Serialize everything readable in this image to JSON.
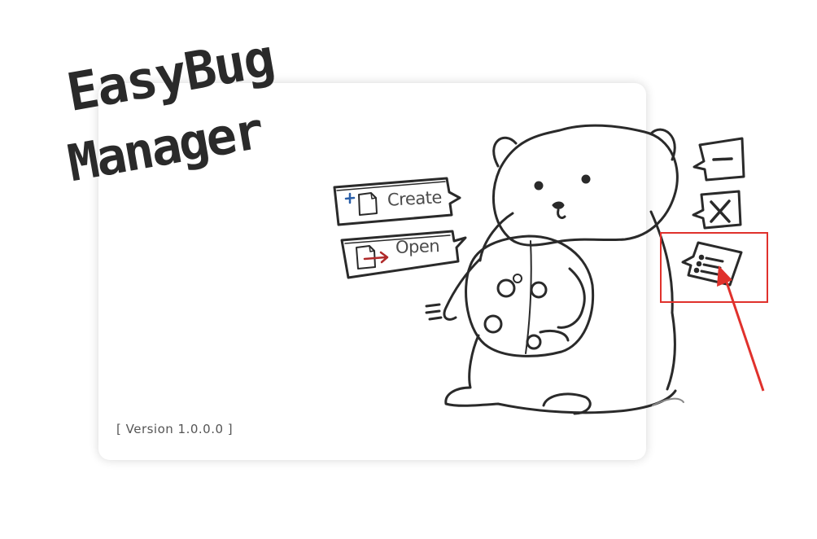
{
  "app": {
    "logo_line1": "EasyBug",
    "logo_line2": "Manager"
  },
  "actions": {
    "create_label": "Create",
    "open_label": "Open"
  },
  "version_text": "[ Version 1.0.0.0 ]",
  "colors": {
    "sketch": "#2a2a2a",
    "highlight": "#e0312c",
    "create_plus": "#2b5fa8",
    "open_arrow": "#b02a2a"
  }
}
